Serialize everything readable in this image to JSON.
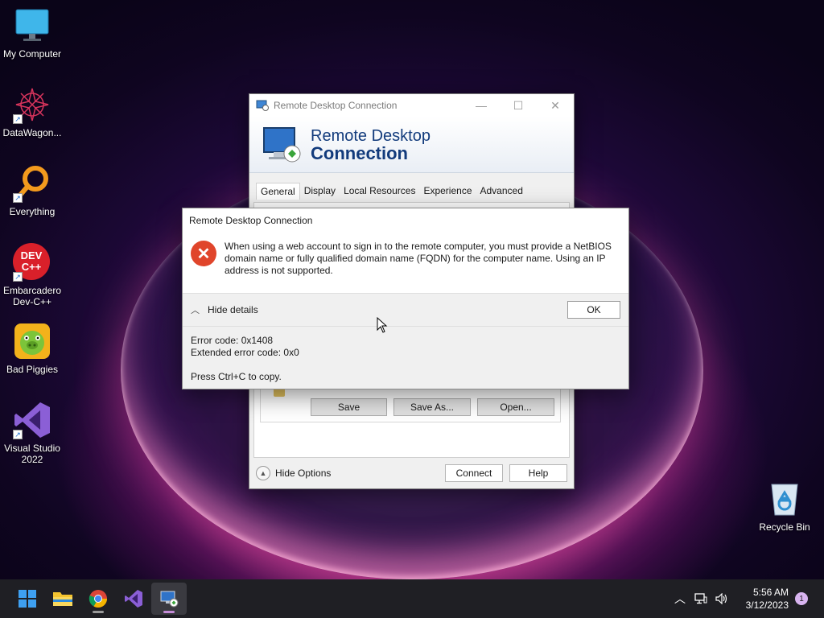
{
  "desktop": {
    "icons": [
      {
        "label": "My Computer"
      },
      {
        "label": "DataWagon..."
      },
      {
        "label": "Everything"
      },
      {
        "label": "Embarcadero Dev-C++"
      },
      {
        "label": "Bad Piggies"
      },
      {
        "label": "Visual Studio 2022"
      },
      {
        "label": "Recycle Bin"
      }
    ],
    "devcpp_icon_text": "DEV C++"
  },
  "rdp_window": {
    "title": "Remote Desktop Connection",
    "banner_line1": "Remote Desktop",
    "banner_line2": "Connection",
    "tabs": [
      {
        "label": "General",
        "active": true
      },
      {
        "label": "Display"
      },
      {
        "label": "Local Resources"
      },
      {
        "label": "Experience"
      },
      {
        "label": "Advanced"
      }
    ],
    "save_button": "Save",
    "save_as_button": "Save As...",
    "open_button": "Open...",
    "hide_options": "Hide Options",
    "connect_button": "Connect",
    "help_button": "Help"
  },
  "error_dialog": {
    "title": "Remote Desktop Connection",
    "message": "When using a web account to sign in to the remote computer, you must provide a NetBIOS domain name or fully qualified domain name (FQDN) for the computer name. Using an IP address is not supported.",
    "hide_details": "Hide details",
    "ok_button": "OK",
    "error_code": "Error code: 0x1408",
    "extended_error_code": "Extended error code: 0x0",
    "copy_hint": "Press Ctrl+C to copy."
  },
  "taskbar": {
    "apps": [
      "start",
      "file-explorer",
      "chrome",
      "visual-studio",
      "remote-desktop"
    ],
    "time": "5:56 AM",
    "date": "3/12/2023",
    "notification_count": "1"
  },
  "colors": {
    "error_red": "#e0452b",
    "banner_blue": "#123b7c",
    "taskbar_bg": "#1f1f24"
  }
}
